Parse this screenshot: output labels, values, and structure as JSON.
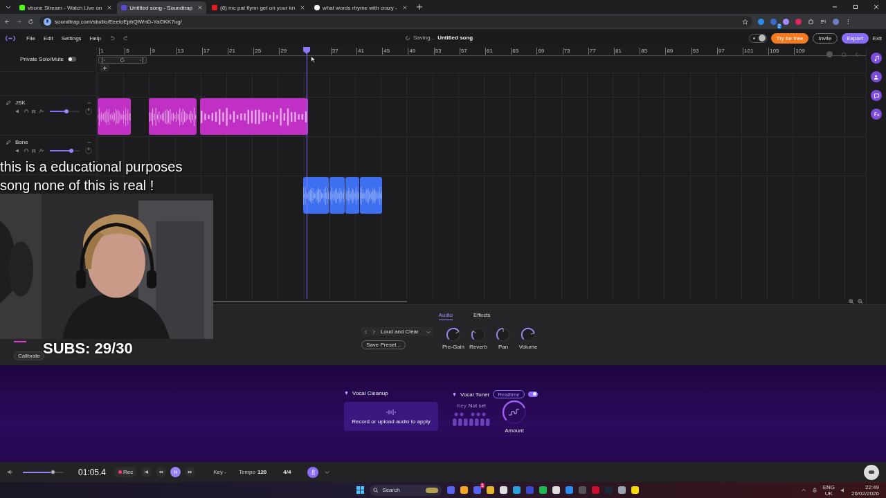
{
  "browser": {
    "tabs": [
      {
        "title": "vbone Stream - Watch Live on",
        "selected": false
      },
      {
        "title": "Untitled song - Soundtrap",
        "selected": true
      },
      {
        "title": "(8) mc pat flynn get on your kn",
        "selected": false
      },
      {
        "title": "what words rhyme with crazy -",
        "selected": false
      }
    ],
    "url": "soundtrap.com/studio/EeeloEpbQIWnD-YaOKK7og/",
    "extension_badge": "2"
  },
  "menu": [
    "File",
    "Edit",
    "Settings",
    "Help"
  ],
  "status": "Saving...",
  "song_title": "Untitled song",
  "dark_mode": true,
  "header_buttons": [
    {
      "kind": "try",
      "label": "Try for free"
    },
    {
      "kind": "invite",
      "label": "Invite"
    },
    {
      "kind": "export",
      "label": "Export"
    },
    {
      "kind": "exit",
      "label": "Exit"
    }
  ],
  "private_solo": {
    "label": "Private Solo/Mute",
    "on": false
  },
  "ruler": [
    {
      "kind": "mark",
      "label": "1"
    },
    {
      "kind": "mark",
      "label": "5"
    },
    {
      "kind": "mark",
      "label": "9"
    },
    {
      "kind": "mark",
      "label": "13"
    },
    {
      "kind": "mark",
      "label": "17"
    },
    {
      "kind": "mark",
      "label": "21"
    },
    {
      "kind": "mark",
      "label": "25"
    },
    {
      "kind": "mark",
      "label": "29"
    },
    {
      "kind": "playhead"
    },
    {
      "kind": "mark",
      "label": "37"
    },
    {
      "kind": "mark",
      "label": "41"
    },
    {
      "kind": "mark",
      "label": "45"
    },
    {
      "kind": "mark",
      "label": "49"
    },
    {
      "kind": "mark",
      "label": "53"
    },
    {
      "kind": "mark",
      "label": "57"
    },
    {
      "kind": "mark",
      "label": "61"
    },
    {
      "kind": "mark",
      "label": "65"
    },
    {
      "kind": "mark",
      "label": "69"
    },
    {
      "kind": "mark",
      "label": "73"
    },
    {
      "kind": "mark",
      "label": "77"
    },
    {
      "kind": "mark",
      "label": "81"
    },
    {
      "kind": "mark",
      "label": "85"
    },
    {
      "kind": "mark",
      "label": "89"
    },
    {
      "kind": "mark",
      "label": "93"
    },
    {
      "kind": "mark",
      "label": "97"
    },
    {
      "kind": "mark",
      "label": "101"
    },
    {
      "kind": "mark",
      "label": "105"
    },
    {
      "kind": "mark",
      "label": "109"
    }
  ],
  "tracks": [
    {
      "name": "JSK",
      "record_label": "R",
      "level": 0.55,
      "clips": [
        {
          "color": "#c030c4"
        },
        {
          "color": "#c030c4"
        },
        {
          "color": "#c030c4"
        }
      ]
    },
    {
      "name": "Bone",
      "record_label": "R",
      "level": 0.72
    },
    {
      "clips": [
        {
          "color": "#3d6ff0"
        },
        {
          "color": "#3d6ff0"
        },
        {
          "color": "#3d6ff0"
        },
        {
          "color": "#3d6ff0"
        }
      ]
    }
  ],
  "overlay": {
    "caption_lines": [
      "this is a educational purposes",
      "song none of this is real !"
    ],
    "subs": "SUBS: 29/30"
  },
  "calibrate": "Calibrate",
  "panel_tabs": [
    {
      "label": "Audio",
      "selected": true
    },
    {
      "label": "Effects",
      "selected": false
    }
  ],
  "preset": "Loud and Clear",
  "save_preset": "Save Preset...",
  "knobs": [
    {
      "label": "Pre-Gain"
    },
    {
      "label": "Reverb"
    },
    {
      "label": "Pan"
    },
    {
      "label": "Volume"
    }
  ],
  "vocal_cleanup": {
    "title": "Vocal Cleanup",
    "hint": "Record or upload audio to apply"
  },
  "vocal_tuner": {
    "title": "Vocal Tuner",
    "mode": "Realtime",
    "on": true,
    "key_label": "Key",
    "key_value": "Not set",
    "amount_label": "Amount"
  },
  "transport": {
    "level": 0.75,
    "time": "01:05.4",
    "rec": "Rec",
    "playing": true,
    "key": "Key -",
    "tempo_label": "Tempo",
    "tempo": "120",
    "meter": "4/4"
  },
  "taskbar": {
    "search": "Search",
    "lang": "ENG",
    "region": "UK",
    "time": "22:49",
    "date": "26/02/2026",
    "notification_badge": "1"
  }
}
